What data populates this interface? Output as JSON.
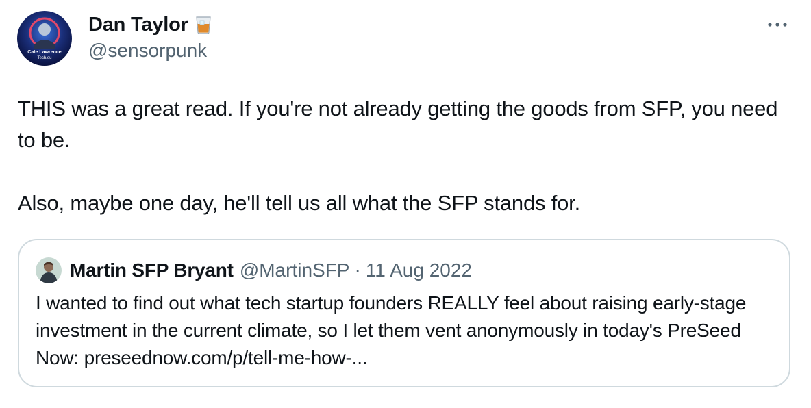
{
  "author": {
    "display_name": "Dan Taylor",
    "name_emoji_icon": "tumbler-glass-icon",
    "handle": "@sensorpunk",
    "avatar_caption_line1": "Cate Lawrence",
    "avatar_caption_line2": "Tech.eu"
  },
  "more_icon": "more-horizontal-icon",
  "tweet": {
    "paragraph1": "THIS was a great read. If you're not already getting the goods from SFP, you need to be.",
    "paragraph2": "Also, maybe one day, he'll tell us all what the SFP stands for."
  },
  "quoted_tweet": {
    "display_name": "Martin SFP Bryant",
    "handle": "@MartinSFP",
    "separator": "·",
    "date": "11 Aug 2022",
    "text": "I wanted to find out what tech startup founders REALLY feel about raising early-stage investment in the current climate, so I let them vent anonymously in today's PreSeed Now: ",
    "link": "preseednow.com/p/tell-me-how-..."
  },
  "colors": {
    "text_primary": "#0f1419",
    "text_secondary": "#536471",
    "border": "#cfd9de"
  }
}
